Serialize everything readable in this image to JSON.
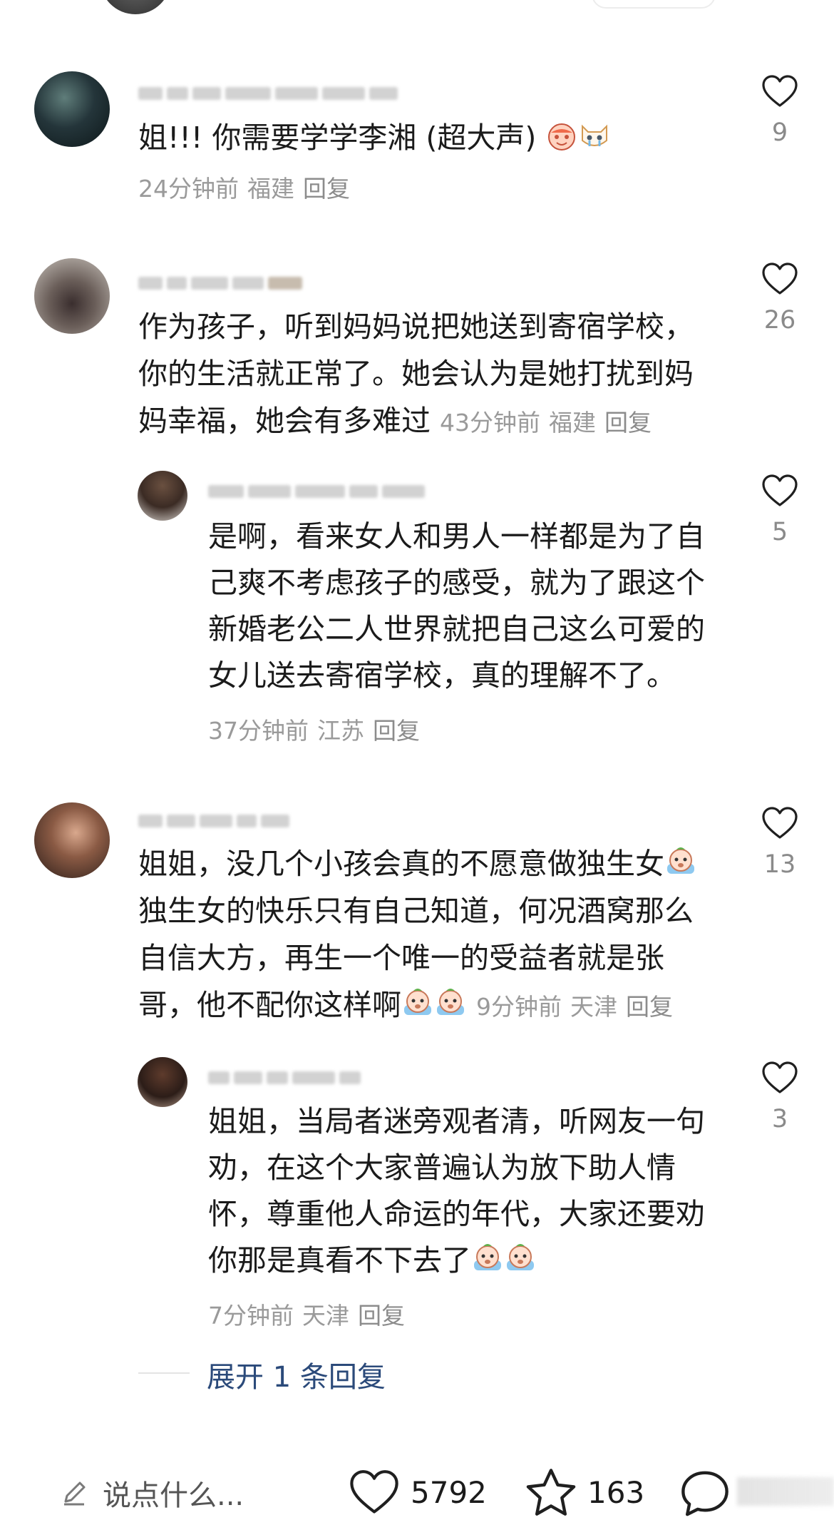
{
  "comments": [
    {
      "text": "姐!!! 你需要学学李湘 (超大声)",
      "emojis": [
        "cry-laugh-face-icon",
        "crying-cat-icon"
      ],
      "time": "24分钟前",
      "location": "福建",
      "reply": "回复",
      "likes": "9"
    },
    {
      "lines": [
        "作为孩子，听到妈妈说把她送到寄宿学校，",
        "你的生活就正常了。她会认为是她打扰到妈",
        "妈幸福，她会有多难过"
      ],
      "time": "43分钟前",
      "location": "福建",
      "reply": "回复",
      "likes": "26",
      "sub_reply": {
        "lines": [
          "是啊，看来女人和男人一样都是为了自",
          "己爽不考虑孩子的感受，就为了跟这个",
          "新婚老公二人世界就把自己这么可爱的",
          "女儿送去寄宿学校，真的理解不了。"
        ],
        "time": "37分钟前",
        "location": "江苏",
        "reply": "回复",
        "likes": "5"
      }
    },
    {
      "lines": [
        "姐姐，没几个小孩会真的不愿意做独生女",
        "独生女的快乐只有自己知道，何况酒窝那么",
        "自信大方，再生一个唯一的受益者就是张",
        "哥，他不配你这样啊"
      ],
      "emojis": [
        "crying-baby-icon"
      ],
      "time": "9分钟前",
      "location": "天津",
      "reply": "回复",
      "likes": "13",
      "sub_reply": {
        "lines": [
          "姐姐，当局者迷旁观者清，听网友一句",
          "劝，在这个大家普遍认为放下助人情",
          "怀，尊重他人命运的年代，大家还要劝",
          "你那是真看不下去了"
        ],
        "time": "7分钟前",
        "location": "天津",
        "reply": "回复",
        "likes": "3"
      }
    }
  ],
  "expand_replies": "展开 1 条回复",
  "bottom_bar": {
    "input_placeholder": "说点什么...",
    "likes": "5792",
    "favorites": "163"
  }
}
